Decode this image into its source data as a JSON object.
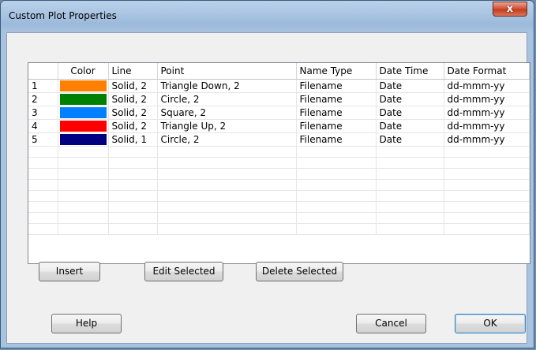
{
  "window": {
    "title": "Custom Plot Properties",
    "close_glyph": "x"
  },
  "grid": {
    "columns": [
      "",
      "Color",
      "Line",
      "Point",
      "Name Type",
      "Date Time",
      "Date Format"
    ],
    "rows": [
      {
        "num": "1",
        "color": "#ff8000",
        "line": "Solid, 2",
        "point": "Triangle Down, 2",
        "name_type": "Filename",
        "date_time": "Date",
        "date_format": "dd-mmm-yy"
      },
      {
        "num": "2",
        "color": "#008000",
        "line": "Solid, 2",
        "point": "Circle, 2",
        "name_type": "Filename",
        "date_time": "Date",
        "date_format": "dd-mmm-yy"
      },
      {
        "num": "3",
        "color": "#0080ff",
        "line": "Solid, 2",
        "point": "Square, 2",
        "name_type": "Filename",
        "date_time": "Date",
        "date_format": "dd-mmm-yy"
      },
      {
        "num": "4",
        "color": "#ff0000",
        "line": "Solid, 2",
        "point": "Triangle Up, 2",
        "name_type": "Filename",
        "date_time": "Date",
        "date_format": "dd-mmm-yy"
      },
      {
        "num": "5",
        "color": "#000080",
        "line": "Solid, 1",
        "point": "Circle, 2",
        "name_type": "Filename",
        "date_time": "Date",
        "date_format": "dd-mmm-yy"
      }
    ],
    "empty_rows": 8
  },
  "buttons": {
    "insert": "Insert",
    "edit_selected": "Edit Selected",
    "delete_selected": "Delete Selected",
    "help": "Help",
    "cancel": "Cancel",
    "ok": "OK"
  }
}
